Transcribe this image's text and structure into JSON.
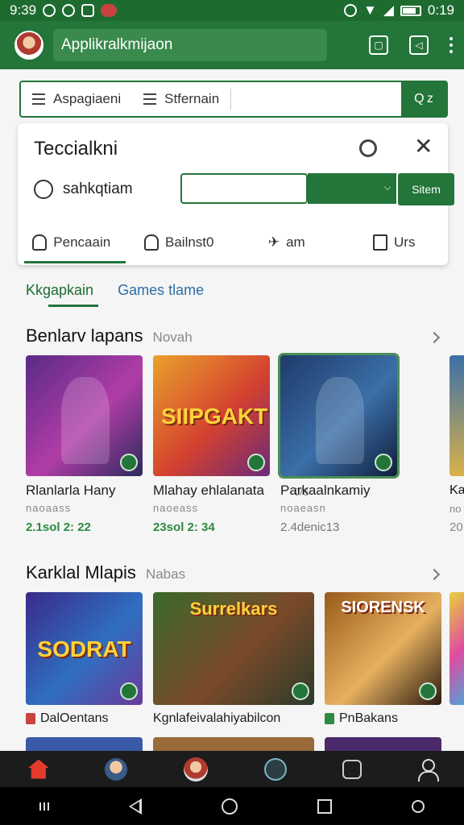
{
  "status_bar": {
    "time": "9:39",
    "battery": "0:19"
  },
  "app_bar": {
    "search_text": "Applikralkmijaon"
  },
  "filter_bar": {
    "filter1": "Aspagiaeni",
    "filter2": "Stfernain",
    "search_button": "Q z"
  },
  "panel": {
    "title": "Teccialkni",
    "row_label": "sahkqtiam",
    "input_value": "",
    "button_label": "Sitem",
    "tabs": [
      {
        "label": "Pencaain",
        "icon": "person-icon"
      },
      {
        "label": "Bailnst0",
        "icon": "bag-icon"
      },
      {
        "label": "am",
        "icon": "plane-icon"
      },
      {
        "label": "Urs",
        "icon": "calendar-icon"
      }
    ]
  },
  "category_tabs": [
    "Kkgapkain",
    "Games tlame"
  ],
  "section1": {
    "title": "Benlarv lapans",
    "subtitle": "Novah",
    "cards": [
      {
        "title": "Rlanlarla Hany",
        "meta": "naoaass",
        "date": "2.1sol 2: 22",
        "colors": [
          "#5a2a86",
          "#b13da7",
          "#2b2a5c"
        ]
      },
      {
        "title": "Mlahay ehlalanata",
        "meta": "naoeass",
        "date": "23sol 2: 34",
        "side": "0/6",
        "word": "SIIPGAKT",
        "colors": [
          "#e9a22c",
          "#d4412f",
          "#6b2a7a"
        ]
      },
      {
        "title": "Parkaalnkamiy",
        "meta": "noaeasn",
        "date": "2.4denic13",
        "colors": [
          "#1e3a6a",
          "#3b6fa8",
          "#0f1e3a"
        ]
      }
    ],
    "peek": {
      "title": "Ka",
      "meta": "no",
      "date": "20"
    }
  },
  "section2": {
    "title": "Karklal Mlapis",
    "subtitle": "Nabas",
    "cards": [
      {
        "title": "DalOentans",
        "word": "SODRAT",
        "colors": [
          "#3a2a8a",
          "#2f6fc0",
          "#6a3a9a"
        ],
        "icon_color": "#c7433f"
      },
      {
        "title": "Kgnlafeivalahiyabilcon",
        "word": "Surrelkars",
        "colors": [
          "#3a6a2a",
          "#7a4a2a",
          "#2a3a2a"
        ]
      },
      {
        "title": "PnBakans",
        "word": "SIORENSK",
        "colors": [
          "#9a5a1a",
          "#e6b060",
          "#2a1a10"
        ],
        "icon_color": "#2f8a42"
      }
    ]
  },
  "bottom_nav": [
    "home-icon",
    "profile-avatar",
    "user-avatar",
    "compass-icon",
    "camera-icon",
    "account-icon"
  ]
}
